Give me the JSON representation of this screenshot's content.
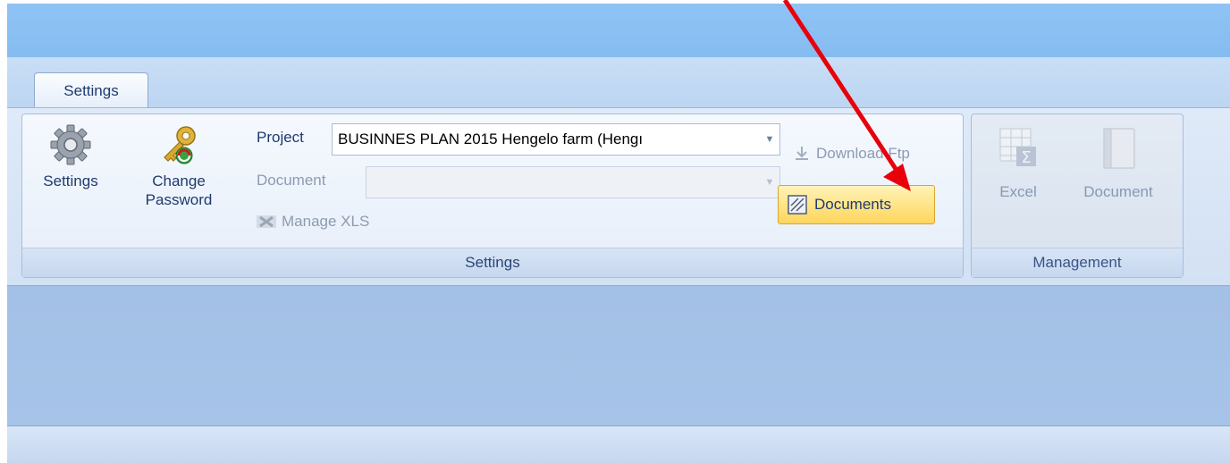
{
  "tabs": [
    {
      "label": "Settings"
    }
  ],
  "ribbon": {
    "settings_group": {
      "label": "Settings",
      "settings_button": "Settings",
      "change_password_line1": "Change",
      "change_password_line2": "Password",
      "project_label": "Project",
      "project_value": "BUSINNES PLAN 2015  Hengelo farm (Hengı",
      "document_label": "Document",
      "document_value": "",
      "manage_xls": "Manage XLS",
      "download_ftp": "Download Ftp",
      "documents_button": "Documents"
    },
    "management_group": {
      "label": "Management",
      "excel_button": "Excel",
      "document_button": "Document"
    }
  },
  "colors": {
    "accent_highlight": "#ffd55c",
    "annotation_arrow": "#e8000b"
  }
}
